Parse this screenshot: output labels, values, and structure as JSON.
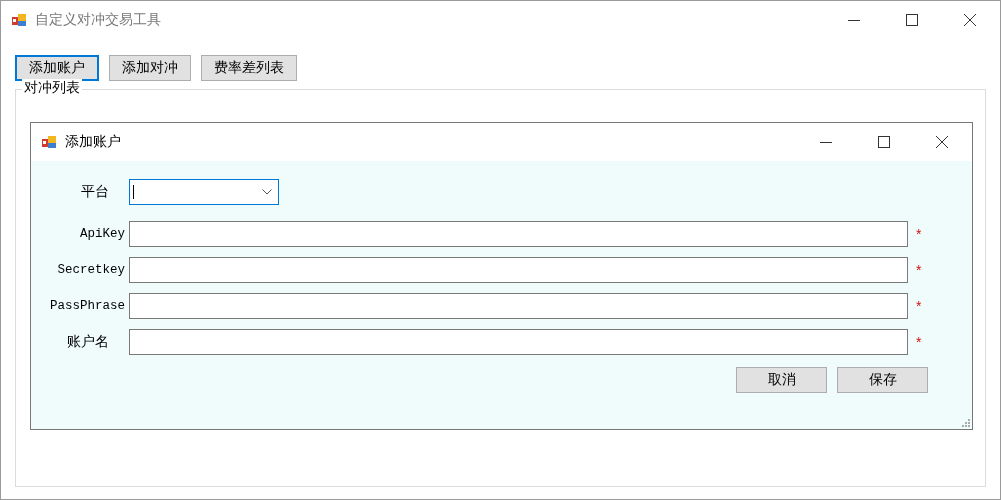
{
  "window": {
    "title": "自定义对冲交易工具"
  },
  "toolbar": [
    {
      "label": "添加账户",
      "focused": true
    },
    {
      "label": "添加对冲",
      "focused": false
    },
    {
      "label": "费率差列表",
      "focused": false
    }
  ],
  "group": {
    "title": "对冲列表"
  },
  "dialog": {
    "title": "添加账户",
    "fields": [
      {
        "label": "平台",
        "kind": "combo",
        "focused": true
      },
      {
        "label": "ApiKey",
        "kind": "text",
        "focused": false,
        "mark": "*"
      },
      {
        "label": "Secretkey",
        "kind": "text",
        "focused": false,
        "mark": "*"
      },
      {
        "label": "PassPhrase",
        "kind": "text",
        "focused": false,
        "mark": "*"
      },
      {
        "label": "账户名",
        "kind": "text",
        "focused": false,
        "mark": "*"
      }
    ],
    "buttons": [
      "取消",
      "保存"
    ]
  }
}
